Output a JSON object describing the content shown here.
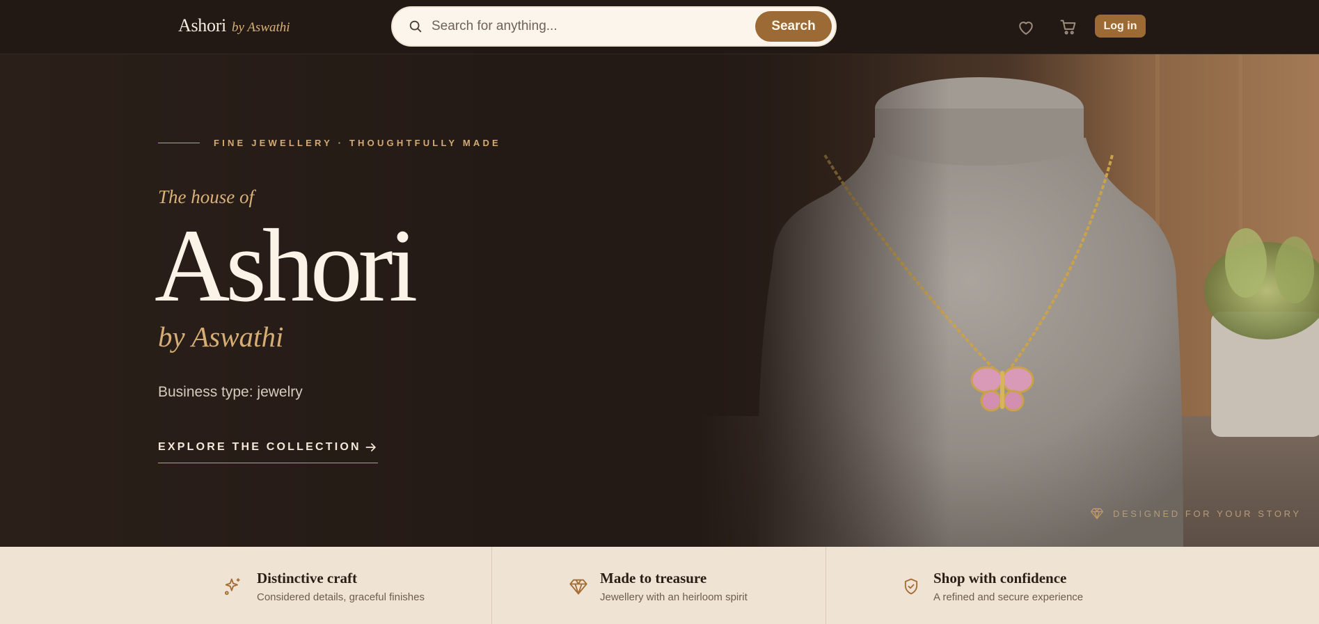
{
  "header": {
    "brand": "Ashori",
    "brand_by": "by Aswathi",
    "search_placeholder": "Search for anything...",
    "search_button": "Search",
    "wishlist_icon": "heart-icon",
    "cart_icon": "cart-icon",
    "login_label": "Log in"
  },
  "hero": {
    "eyebrow": "FINE JEWELLERY · THOUGHTFULLY MADE",
    "intro": "The house of",
    "name": "Ashori",
    "byline": "by Aswathi",
    "business_type": "Business type: jewelry",
    "cta_label": "EXPLORE THE COLLECTION",
    "tagline": "DESIGNED FOR YOUR STORY"
  },
  "features": [
    {
      "icon": "sparkle-icon",
      "title": "Distinctive craft",
      "subtitle": "Considered details, graceful finishes"
    },
    {
      "icon": "diamond-icon",
      "title": "Made to treasure",
      "subtitle": "Jewellery with an heirloom spirit"
    },
    {
      "icon": "shield-check-icon",
      "title": "Shop with confidence",
      "subtitle": "A refined and secure experience"
    }
  ],
  "colors": {
    "background": "#211814",
    "accent": "#9c6a35",
    "gold_text": "#d5ad75",
    "cream": "#fbf3e7",
    "features_bg": "#efe3d3"
  }
}
